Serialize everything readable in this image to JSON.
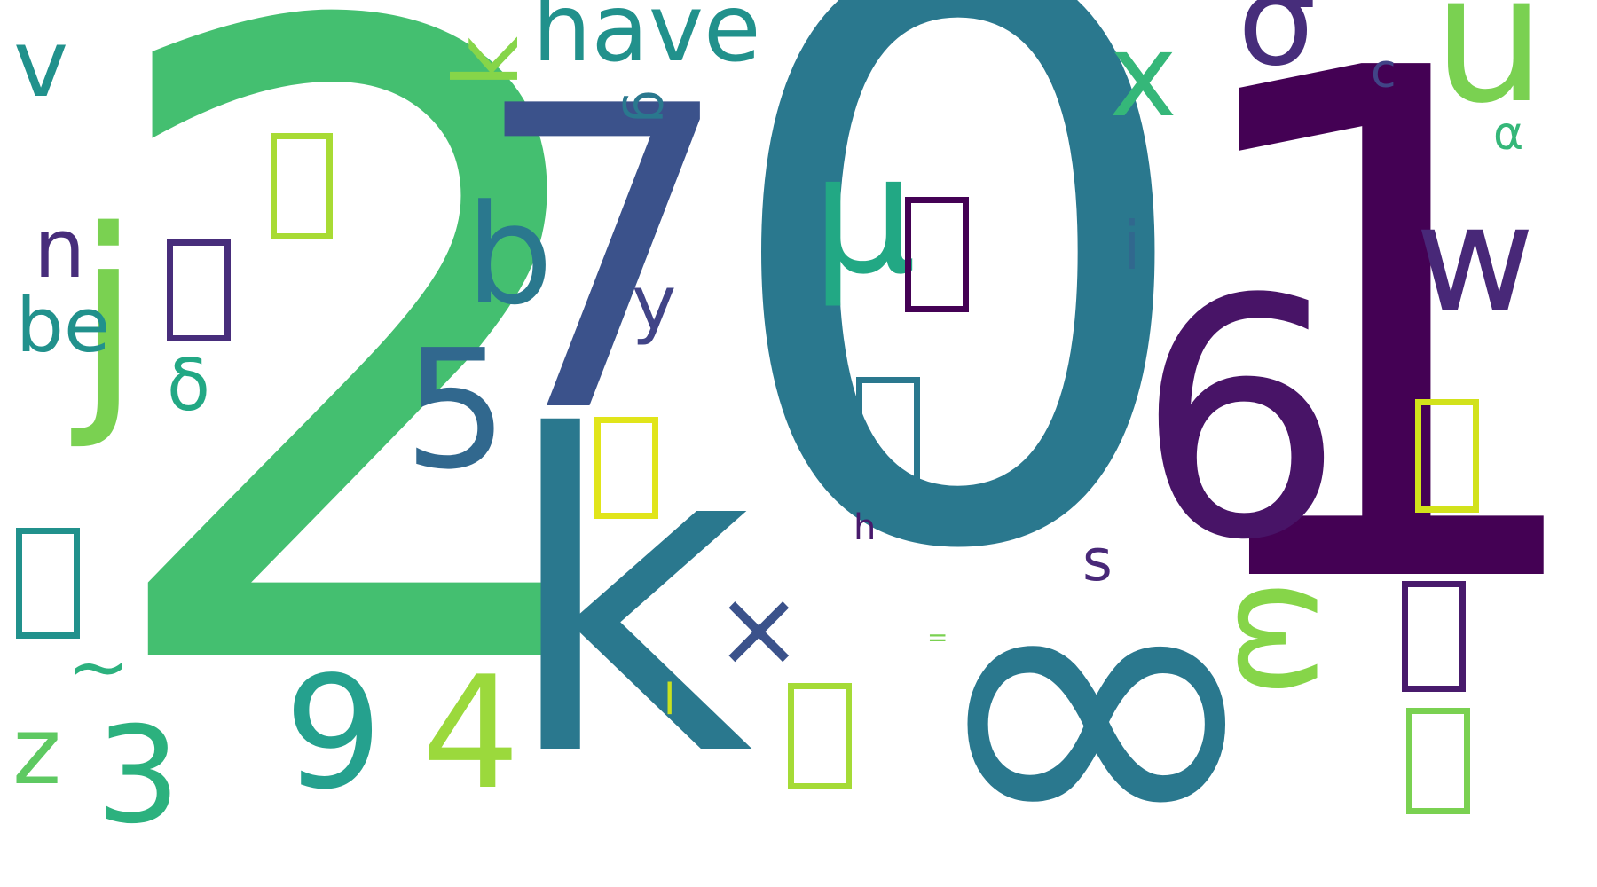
{
  "cloud": {
    "words": [
      {
        "text": "2",
        "color": "#44bf70"
      },
      {
        "text": "0",
        "color": "#2a788e"
      },
      {
        "text": "1",
        "color": "#440154"
      },
      {
        "text": "7",
        "color": "#3b528b"
      },
      {
        "text": "k",
        "color": "#2a788e"
      },
      {
        "text": "∞",
        "color": "#2a788e"
      },
      {
        "text": "6",
        "color": "#481467"
      },
      {
        "text": "5",
        "color": "#31688e"
      },
      {
        "text": "9",
        "color": "#25a18e"
      },
      {
        "text": "4",
        "color": "#9bd93c"
      },
      {
        "text": "3",
        "color": "#2cb17e"
      },
      {
        "text": "μ",
        "color": "#22a884"
      },
      {
        "text": "b",
        "color": "#2a788e"
      },
      {
        "text": "j",
        "color": "#7ad151"
      },
      {
        "text": "u",
        "color": "#7ad151"
      },
      {
        "text": "w",
        "color": "#482878"
      },
      {
        "text": "x",
        "color": "#35b779"
      },
      {
        "text": "v",
        "color": "#21918c"
      },
      {
        "text": "have",
        "color": "#21918c"
      },
      {
        "text": "σ",
        "color": "#472d7b"
      },
      {
        "text": "be",
        "color": "#21918c"
      },
      {
        "text": "n",
        "color": "#472d7b"
      },
      {
        "text": "δ",
        "color": "#22a884"
      },
      {
        "text": "z",
        "color": "#5ec962"
      },
      {
        "text": "~",
        "color": "#2cb17e"
      },
      {
        "text": "y",
        "color": "#414487"
      },
      {
        "text": "i",
        "color": "#31688e"
      },
      {
        "text": "×",
        "color": "#3b528b"
      },
      {
        "text": "ω",
        "color": "#86d549"
      },
      {
        "text": "c",
        "color": "#414487"
      },
      {
        "text": "α",
        "color": "#35b779"
      },
      {
        "text": "s",
        "color": "#482878"
      },
      {
        "text": "h",
        "color": "#481a6c"
      },
      {
        "text": "l",
        "color": "#c8e020"
      },
      {
        "text": "=",
        "color": "#7ad151"
      },
      {
        "text": "k",
        "color": "#86d549"
      },
      {
        "text": "g",
        "color": "#2a788e"
      }
    ],
    "boxes": [
      {
        "color": "#a8db34"
      },
      {
        "color": "#472d7b"
      },
      {
        "color": "#440154"
      },
      {
        "color": "#2a788e"
      },
      {
        "color": "#21918c"
      },
      {
        "color": "#e1e51a"
      },
      {
        "color": "#d2e21b"
      },
      {
        "color": "#a5db36"
      },
      {
        "color": "#481a6c"
      },
      {
        "color": "#7ad151"
      }
    ]
  }
}
